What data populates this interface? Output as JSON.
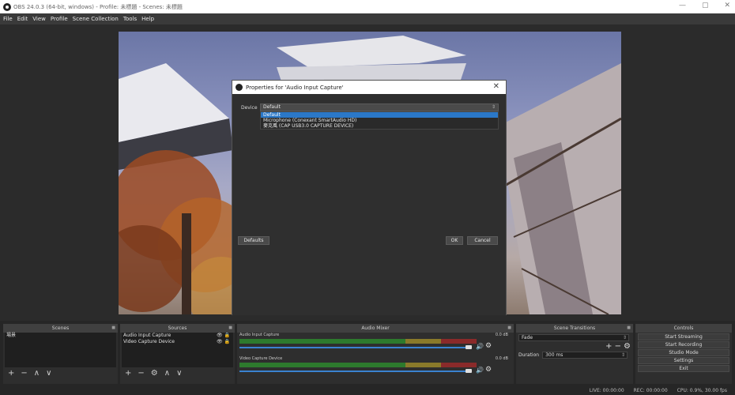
{
  "window": {
    "title": "OBS 24.0.3 (64-bit, windows) - Profile: 未標題 - Scenes: 未標題",
    "minimize_glyph": "—",
    "maximize_glyph": "▢",
    "close_glyph": "✕"
  },
  "menu": [
    "File",
    "Edit",
    "View",
    "Profile",
    "Scene Collection",
    "Tools",
    "Help"
  ],
  "dialog": {
    "title": "Properties for 'Audio Input Capture'",
    "close_glyph": "✕",
    "device_label": "Device",
    "device_value": "Default",
    "dropdown_arrow": "⇕",
    "options": [
      "Default",
      "Microphone (Conexant SmartAudio HD)",
      "麥克風 (CAP USB3.0 CAPTURE DEVICE)"
    ],
    "defaults_label": "Defaults",
    "ok_label": "OK",
    "cancel_label": "Cancel"
  },
  "docks": {
    "scenes": {
      "title": "Scenes",
      "items": [
        "場景"
      ],
      "footer": [
        "+",
        "−",
        "∧",
        "∨"
      ]
    },
    "sources": {
      "title": "Sources",
      "items": [
        {
          "name": "Audio Input Capture",
          "icons": "👁 🔒"
        },
        {
          "name": "Video Capture Device",
          "icons": "👁 🔒"
        }
      ],
      "footer": [
        "+",
        "−",
        "⚙",
        "∧",
        "∨"
      ]
    },
    "mixer": {
      "title": "Audio Mixer",
      "tracks": [
        {
          "name": "Audio Input Capture",
          "db": "0.0 dB"
        },
        {
          "name": "Video Capture Device",
          "db": "0.0 dB"
        }
      ],
      "volume_icon": "🔊",
      "gear_icon": "⚙"
    },
    "transitions": {
      "title": "Scene Transitions",
      "selected": "Fade",
      "add_remove": "+ −",
      "gear": "⚙",
      "duration_label": "Duration",
      "duration_value": "300 ms"
    },
    "controls": {
      "title": "Controls",
      "buttons": [
        "Start Streaming",
        "Start Recording",
        "Studio Mode",
        "Settings",
        "Exit"
      ]
    }
  },
  "status": {
    "live": "LIVE: 00:00:00",
    "rec": "REC: 00:00:00",
    "cpu": "CPU: 0.9%, 30.00 fps"
  }
}
